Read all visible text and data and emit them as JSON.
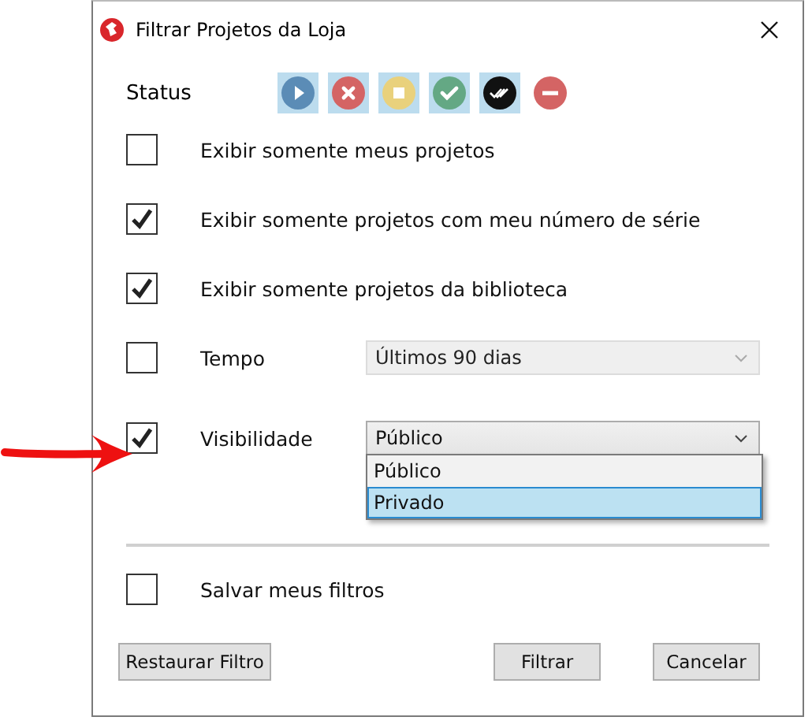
{
  "window": {
    "title": "Filtrar Projetos da Loja"
  },
  "status": {
    "label": "Status",
    "filters": [
      {
        "kind": "play",
        "selected": true
      },
      {
        "kind": "cancel",
        "selected": true
      },
      {
        "kind": "stop",
        "selected": true
      },
      {
        "kind": "done",
        "selected": true
      },
      {
        "kind": "done-all",
        "selected": true
      },
      {
        "kind": "blocked",
        "selected": false
      }
    ]
  },
  "options": [
    {
      "label": "Exibir somente meus projetos",
      "checked": false
    },
    {
      "label": "Exibir somente projetos com meu número de série",
      "checked": true
    },
    {
      "label": "Exibir somente projetos da biblioteca",
      "checked": true
    },
    {
      "label": "Tempo",
      "checked": false,
      "dropdown": {
        "value": "Últimos 90 dias",
        "disabled": true,
        "expanded": false
      }
    },
    {
      "label": "Visibilidade",
      "checked": true,
      "dropdown": {
        "value": "Público",
        "disabled": false,
        "expanded": true,
        "items": [
          {
            "label": "Público",
            "highlighted": false
          },
          {
            "label": "Privado",
            "highlighted": true
          }
        ]
      }
    }
  ],
  "save": {
    "label": "Salvar meus filtros",
    "checked": false
  },
  "buttons": [
    "Restaurar Filtro",
    "Filtrar",
    "Cancelar"
  ]
}
